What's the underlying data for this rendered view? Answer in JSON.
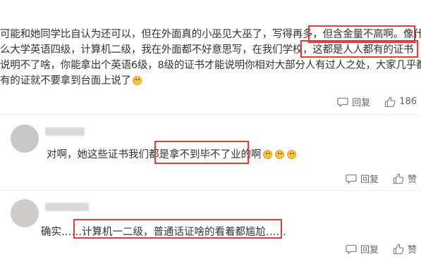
{
  "comments": [
    {
      "lines": [
        "可能和她同学比自认为还可以，但在外面真的小巫见大巫了，写得再多，但含金量不高啊。像什",
        "么大学英语四级，计算机二级，我在外面都不好意思写，在我们学校，这都是人人都有的证书",
        "说明不了啥，你能拿出个英语6级，8级的证书才能说明你相对大部分人有过人之处，大家几乎都",
        "有的证就不要拿到台面上说了"
      ],
      "emoji": "grinning-sweat-emoji",
      "reply_label": "回复",
      "like_count": "186"
    },
    {
      "text": "对啊，她这些证书我们都是拿不到毕不了业的啊",
      "emoji": "laughing-tears-emoji",
      "reply_label": "回复",
      "like_label": "赞"
    },
    {
      "text": "确实……计算机一二级，普通话证啥的看着都尴尬……",
      "reply_label": "回复",
      "like_label": "赞"
    }
  ],
  "colors": {
    "highlight": "#e23b3b",
    "text": "#333333",
    "meta": "#666666"
  }
}
